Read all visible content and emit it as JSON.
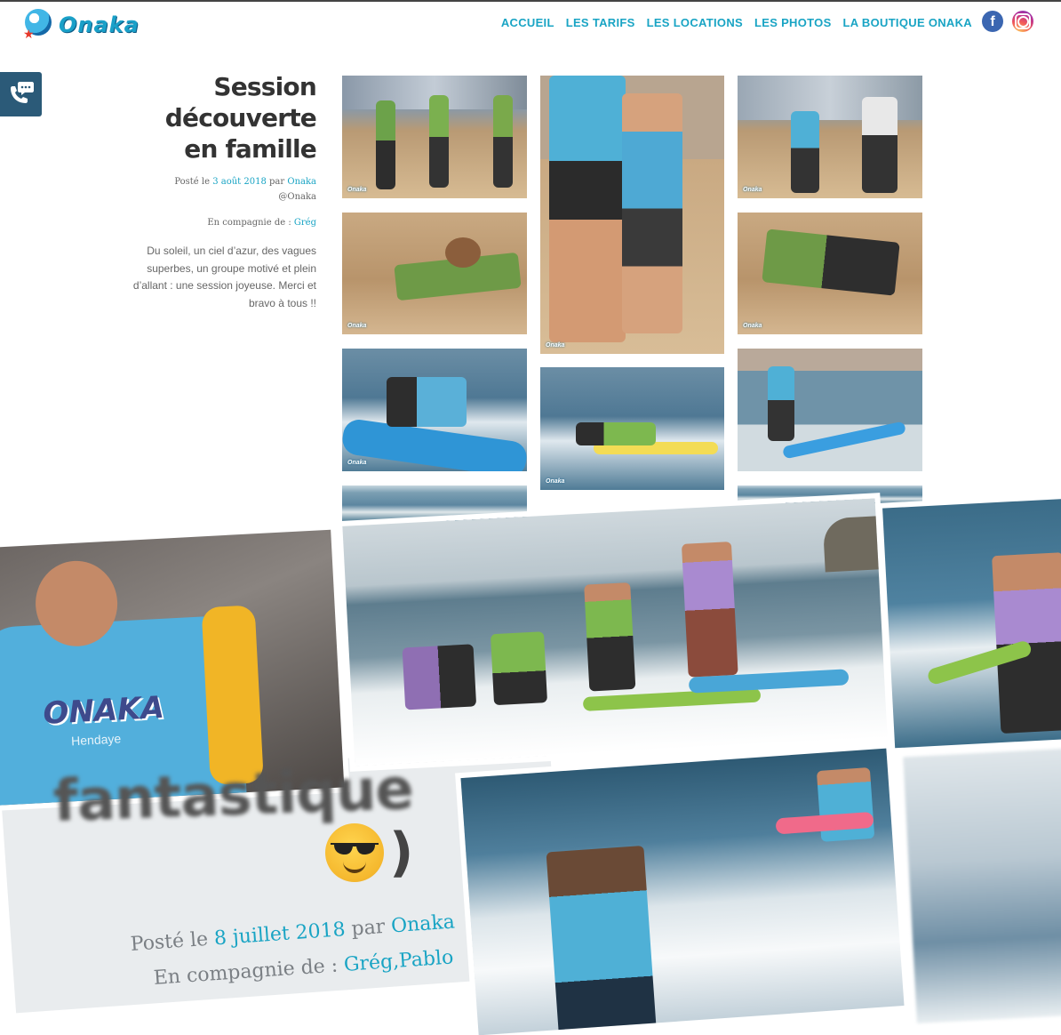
{
  "brand": {
    "name": "Onaka"
  },
  "nav": {
    "items": [
      "ACCUEIL",
      "LES TARIFS",
      "LES LOCATIONS",
      "LES PHOTOS",
      "LA BOUTIQUE ONAKA"
    ],
    "facebook_icon": "facebook-icon",
    "instagram_icon": "instagram-icon"
  },
  "colors": {
    "accent": "#19a4c4",
    "contact_tab": "#2b5a78",
    "facebook": "#3b66b1"
  },
  "post1": {
    "title": "Session découverte en famille",
    "posted_prefix": "Posté le",
    "date": "3 août 2018",
    "by": "par",
    "author": "Onaka",
    "author_handle": "@Onaka",
    "company_label": "En compagnie de :",
    "company": "Grég",
    "excerpt": "Du soleil, un ciel d’azur, des vagues superbes, un groupe motivé et plein d’allant : une session joyeuse. Merci et bravo à tous !!",
    "photo_watermark": "Onaka"
  },
  "post2": {
    "title_fragment": "fantastique",
    "closing_paren": ")",
    "posted_prefix": "Posté le",
    "date": "8 juillet 2018",
    "by": "par",
    "author": "Onaka",
    "company_label": "En compagnie de :",
    "company": "Grég,Pablo",
    "emoji": "smiling-face-with-sunglasses"
  },
  "shirt_print": {
    "brand": "ONAKA",
    "town": "Hendaye"
  }
}
